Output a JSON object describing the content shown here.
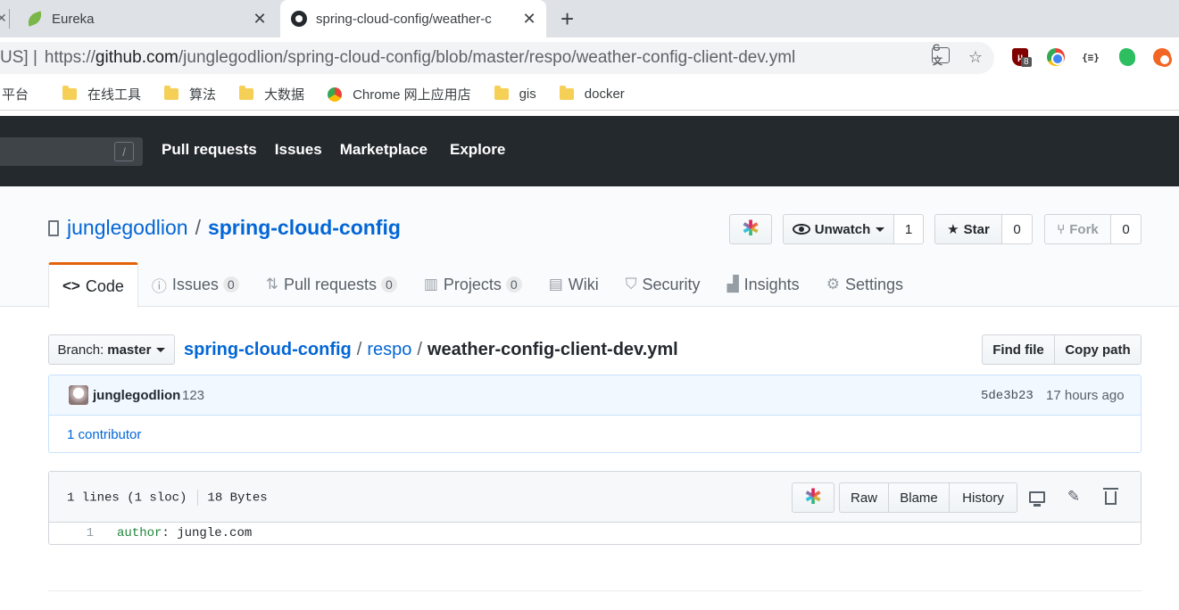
{
  "browser": {
    "tabs": [
      {
        "title": "Eureka",
        "close": "✕"
      },
      {
        "title": "spring-cloud-config/weather-c",
        "close": "✕"
      }
    ],
    "stub_close": "✕",
    "new_tab": "+",
    "omnibox": {
      "prefix": "US] | ",
      "url_scheme": "https://",
      "url_host": "github.com",
      "url_path": "/junglegodlion/spring-cloud-config/blob/master/respo/weather-config-client-dev.yml"
    },
    "omnibox_icons": {
      "translate": "G文",
      "star": "☆"
    },
    "extensions": {
      "ublock_badge": "8",
      "json": "{≡}"
    }
  },
  "bookmarks": {
    "items": [
      {
        "label": "平台",
        "icon": "none"
      },
      {
        "label": "在线工具",
        "icon": "folder-icon"
      },
      {
        "label": "算法",
        "icon": "folder-icon"
      },
      {
        "label": "大数据",
        "icon": "folder-icon"
      },
      {
        "label": "Chrome 网上应用店",
        "icon": "chrome-webstore-icon"
      },
      {
        "label": "gis",
        "icon": "folder-icon"
      },
      {
        "label": "docker",
        "icon": "folder-icon"
      }
    ]
  },
  "github": {
    "search_slash": "/",
    "nav": [
      "Pull requests",
      "Issues",
      "Marketplace",
      "Explore"
    ],
    "repo": {
      "owner": "junglegodlion",
      "separator": "/",
      "name": "spring-cloud-config"
    },
    "actions": {
      "watch_label": "Unwatch",
      "watch_count": "1",
      "star_label": "Star",
      "star_count": "0",
      "fork_label": "Fork",
      "fork_count": "0"
    },
    "tabs": [
      {
        "label": "Code",
        "icon": "code-icon",
        "glyph": "<>",
        "count": ""
      },
      {
        "label": "Issues",
        "icon": "issue-icon",
        "glyph": "ⓘ",
        "count": "0"
      },
      {
        "label": "Pull requests",
        "icon": "pull-request-icon",
        "glyph": "⇅",
        "count": "0"
      },
      {
        "label": "Projects",
        "icon": "project-icon",
        "glyph": "▥",
        "count": "0"
      },
      {
        "label": "Wiki",
        "icon": "book-icon",
        "glyph": "▤",
        "count": ""
      },
      {
        "label": "Security",
        "icon": "shield-icon",
        "glyph": "⛉",
        "count": ""
      },
      {
        "label": "Insights",
        "icon": "graph-icon",
        "glyph": "▟",
        "count": ""
      },
      {
        "label": "Settings",
        "icon": "gear-icon",
        "glyph": "⚙",
        "count": ""
      }
    ],
    "branch": {
      "prefix": "Branch:",
      "name": "master"
    },
    "breadcrumb": {
      "root": "spring-cloud-config",
      "sep": "/",
      "dir": "respo",
      "file": "weather-config-client-dev.yml"
    },
    "find_file": "Find file",
    "copy_path": "Copy path",
    "commit": {
      "author": "junglegodlion",
      "message": "123",
      "sha": "5de3b23",
      "time": "17 hours ago",
      "contributors": "1 contributor"
    },
    "file": {
      "lines_info": "1 lines (1 sloc)",
      "size": "18 Bytes",
      "raw": "Raw",
      "blame": "Blame",
      "history": "History",
      "line_number": "1",
      "code_key": "author",
      "code_colon": ":",
      "code_value": " jungle.com"
    }
  }
}
